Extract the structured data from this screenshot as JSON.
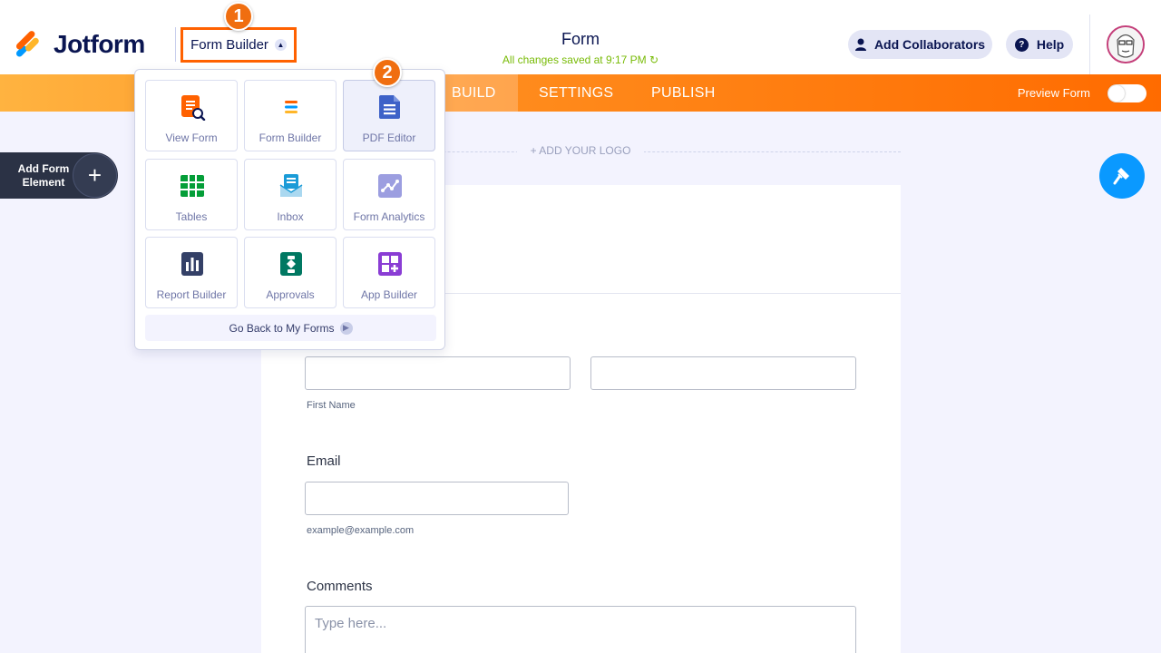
{
  "header": {
    "logo_text": "Jotform",
    "form_builder_toggle": "Form Builder",
    "form_title": "Form",
    "saved_status": "All changes saved at 9:17 PM",
    "add_collaborators": "Add Collaborators",
    "help": "Help"
  },
  "nav": {
    "tabs": [
      "BUILD",
      "SETTINGS",
      "PUBLISH"
    ],
    "active_tab": "BUILD",
    "preview_label": "Preview Form",
    "preview_enabled": false
  },
  "add_element": {
    "label": "Add Form Element"
  },
  "dropdown": {
    "tiles": [
      {
        "label": "View Form",
        "icon": "view-form-icon"
      },
      {
        "label": "Form Builder",
        "icon": "form-builder-icon"
      },
      {
        "label": "PDF Editor",
        "icon": "pdf-editor-icon"
      },
      {
        "label": "Tables",
        "icon": "tables-icon"
      },
      {
        "label": "Inbox",
        "icon": "inbox-icon"
      },
      {
        "label": "Form Analytics",
        "icon": "form-analytics-icon"
      },
      {
        "label": "Report Builder",
        "icon": "report-builder-icon"
      },
      {
        "label": "Approvals",
        "icon": "approvals-icon"
      },
      {
        "label": "App Builder",
        "icon": "app-builder-icon"
      }
    ],
    "selected_tile": "PDF Editor",
    "go_back": "Go Back to My Forms"
  },
  "form": {
    "add_logo": "+ ADD YOUR LOGO",
    "first_name_sublabel": "First Name",
    "email_label": "Email",
    "email_sublabel": "example@example.com",
    "comments_label": "Comments",
    "comments_placeholder": "Type here..."
  },
  "badges": [
    "1",
    "2"
  ],
  "colors": {
    "accent_orange": "#ff6100",
    "navy": "#0a1551",
    "saved_green": "#78bb07",
    "fab_blue": "#0a99ff"
  }
}
